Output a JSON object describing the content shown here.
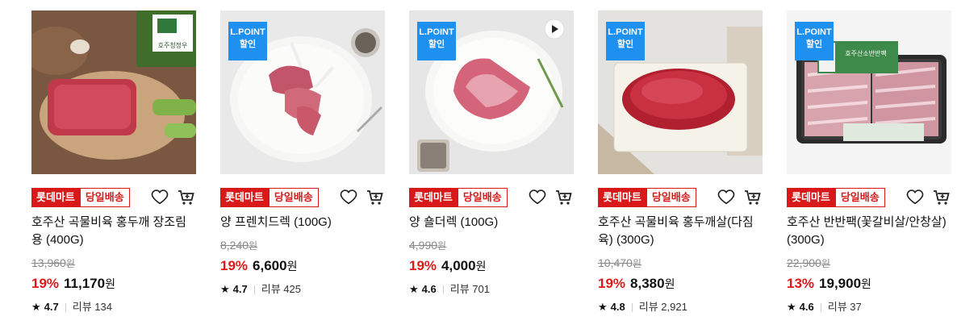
{
  "products": [
    {
      "badge_line1": "",
      "badge_line2": "",
      "tag_mart": "롯데마트",
      "tag_delivery": "당일배송",
      "name": "호주산 곡물비육 홍두깨 장조림용 (400G)",
      "original_price": "13,960",
      "discount": "19%",
      "price": "11,170",
      "won": "원",
      "rating": "4.7",
      "review_label": "리뷰",
      "review_count": "134",
      "flag_text": "호주청정우"
    },
    {
      "badge_line1": "L.POINT",
      "badge_line2": "할인",
      "tag_mart": "롯데마트",
      "tag_delivery": "당일배송",
      "name": "양 프렌치드렉 (100G)",
      "original_price": "8,240",
      "discount": "19%",
      "price": "6,600",
      "won": "원",
      "rating": "4.7",
      "review_label": "리뷰",
      "review_count": "425"
    },
    {
      "badge_line1": "L.POINT",
      "badge_line2": "할인",
      "tag_mart": "롯데마트",
      "tag_delivery": "당일배송",
      "name": "양 숄더렉 (100G)",
      "original_price": "4,990",
      "discount": "19%",
      "price": "4,000",
      "won": "원",
      "rating": "4.6",
      "review_label": "리뷰",
      "review_count": "701"
    },
    {
      "badge_line1": "L.POINT",
      "badge_line2": "할인",
      "tag_mart": "롯데마트",
      "tag_delivery": "당일배송",
      "name": "호주산 곡물비육 홍두깨살(다짐육) (300G)",
      "original_price": "10,470",
      "discount": "19%",
      "price": "8,380",
      "won": "원",
      "rating": "4.8",
      "review_label": "리뷰",
      "review_count": "2,921"
    },
    {
      "badge_line1": "L.POINT",
      "badge_line2": "할인",
      "tag_mart": "롯데마트",
      "tag_delivery": "당일배송",
      "name": "호주산 반반팩(꽃갈비살/안창살) (300G)",
      "original_price": "22,900",
      "discount": "13%",
      "price": "19,900",
      "won": "원",
      "rating": "4.6",
      "review_label": "리뷰",
      "review_count": "37",
      "pack_label": "호주산소반반팩"
    }
  ],
  "colors": {
    "accent_red": "#d91919",
    "lpoint_blue": "#1e90f0"
  },
  "icons": [
    "heart-icon",
    "cart-icon",
    "star-icon",
    "play-icon"
  ]
}
